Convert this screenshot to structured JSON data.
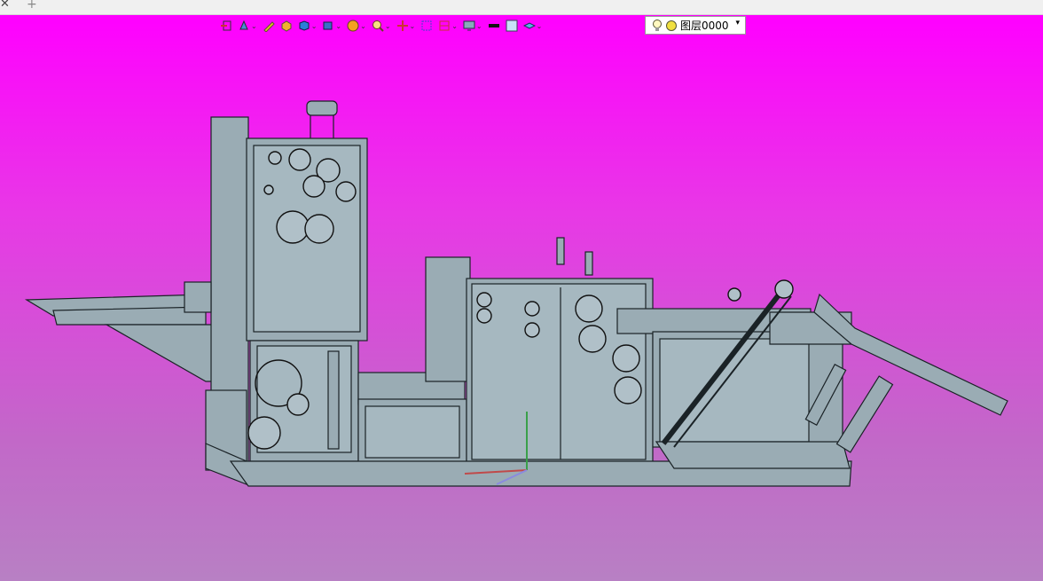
{
  "tabs": {
    "close_glyph": "✕",
    "add_glyph": "+"
  },
  "toolbar": {
    "items": [
      {
        "name": "view-orient-icon",
        "dropdown": false
      },
      {
        "name": "view-manipulate-icon",
        "dropdown": true
      },
      {
        "name": "sketch-pen-icon",
        "dropdown": false
      },
      {
        "name": "display-box-icon",
        "dropdown": false
      },
      {
        "name": "cube-icon",
        "dropdown": true
      },
      {
        "name": "section-view-icon",
        "dropdown": true
      },
      {
        "name": "render-sphere-icon",
        "dropdown": true
      },
      {
        "name": "zoom-icon",
        "dropdown": true
      },
      {
        "name": "rotate-axes-icon",
        "dropdown": true
      },
      {
        "name": "fit-view-icon",
        "dropdown": false
      },
      {
        "name": "standard-views-icon",
        "dropdown": true
      },
      {
        "name": "monitor-icon",
        "dropdown": true
      },
      {
        "name": "line-color-icon",
        "dropdown": false
      },
      {
        "name": "fill-color-icon",
        "dropdown": false
      },
      {
        "name": "layer-tool-icon",
        "dropdown": true
      }
    ],
    "dropdown_glyph": "⌄"
  },
  "layer_selector": {
    "value": "图层0000",
    "arrow": "▾"
  },
  "colors": {
    "background_top": "#ff00ff",
    "background_bottom": "#b880c4",
    "model_fill": "#9aacb4",
    "model_stroke": "#1a2226"
  }
}
